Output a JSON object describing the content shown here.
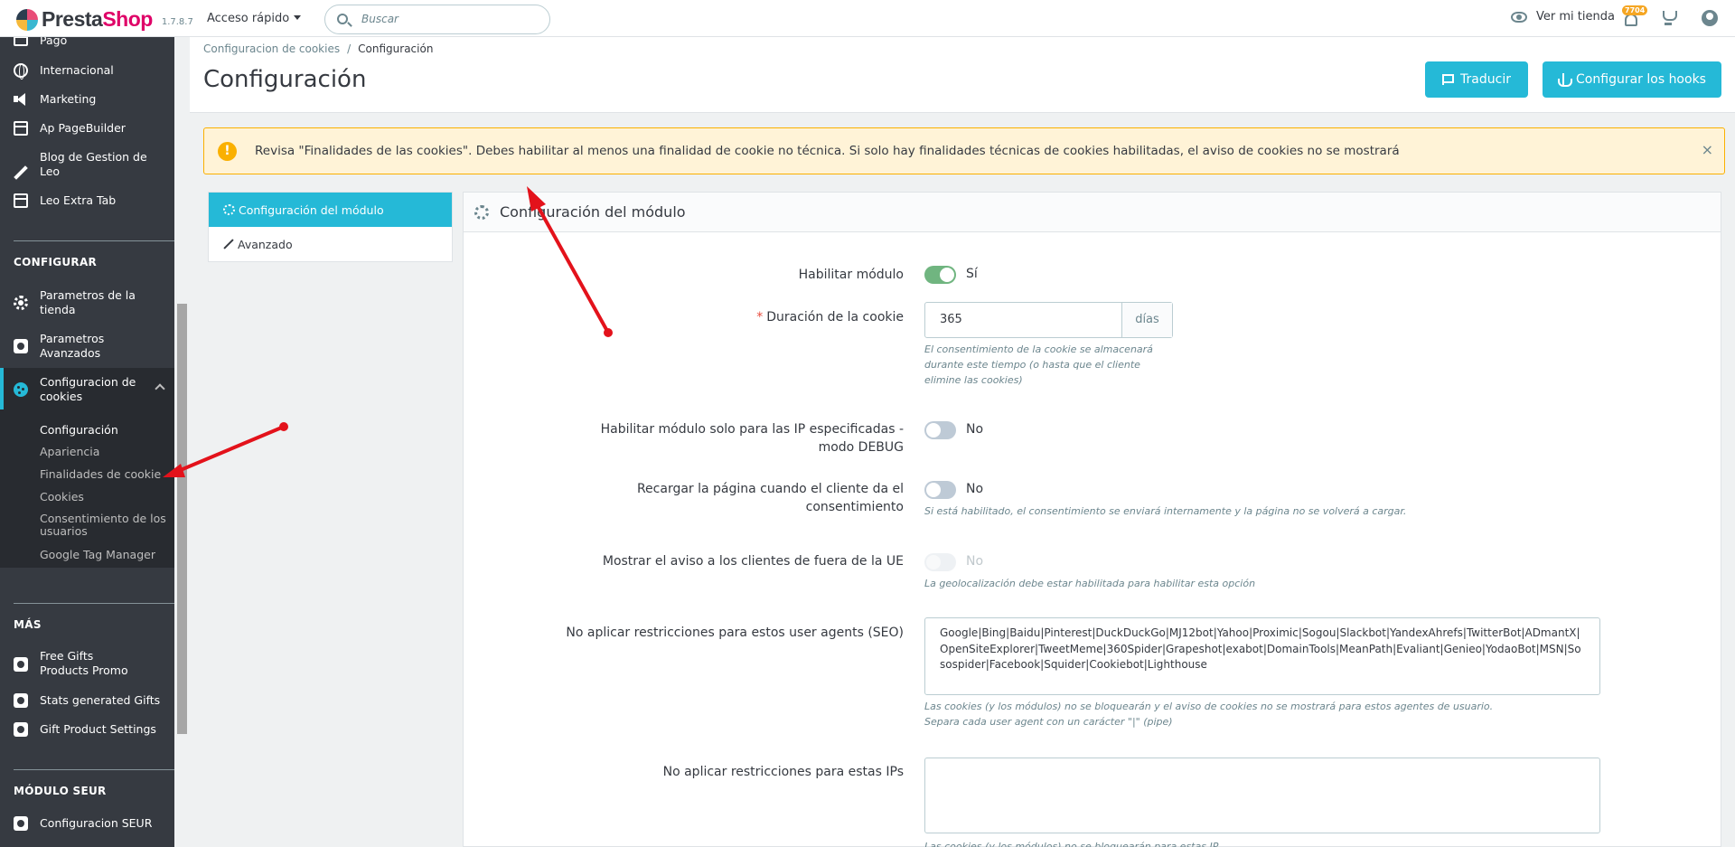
{
  "header": {
    "logo_text_1": "Presta",
    "logo_text_2": "Shop",
    "version": "1.7.8.7",
    "quick_access": "Acceso rápido",
    "search_placeholder": "Buscar",
    "view_store": "Ver mi tienda",
    "notifications_count": "7704"
  },
  "sidebar": {
    "items_top": [
      {
        "label": "Pago",
        "icon": "credit-card-icon"
      },
      {
        "label": "Internacional",
        "icon": "globe-icon"
      },
      {
        "label": "Marketing",
        "icon": "megaphone-icon"
      },
      {
        "label": "Ap PageBuilder",
        "icon": "window-icon"
      },
      {
        "label": "Blog de Gestion de Leo",
        "icon": "pencil-icon"
      },
      {
        "label": "Leo Extra Tab",
        "icon": "window-icon"
      }
    ],
    "section_configurar": "CONFIGURAR",
    "configurar_items": [
      {
        "label": "Parametros de la tienda",
        "icon": "gear-icon"
      },
      {
        "label": "Parametros Avanzados",
        "icon": "puzzle-icon"
      },
      {
        "label": "Configuracion de cookies",
        "icon": "cookie-icon"
      }
    ],
    "cookie_sub_items": [
      "Configuración",
      "Apariencia",
      "Finalidades de cookie",
      "Cookies",
      "Consentimiento de los usuarios",
      "Google Tag Manager"
    ],
    "section_mas": "MÁS",
    "mas_items": [
      {
        "label": "Free Gifts Products Promo",
        "icon": "puzzle-icon"
      },
      {
        "label": "Stats generated Gifts",
        "icon": "puzzle-icon"
      },
      {
        "label": "Gift Product Settings",
        "icon": "puzzle-icon"
      }
    ],
    "section_seur": "MÓDULO SEUR",
    "seur_items": [
      {
        "label": "Configuracion SEUR",
        "icon": "puzzle-icon"
      }
    ]
  },
  "page": {
    "breadcrumb_parent": "Configuracion de cookies",
    "breadcrumb_sep": "/",
    "breadcrumb_current": "Configuración",
    "title": "Configuración",
    "btn_translate": "Traducir",
    "btn_hooks": "Configurar los hooks"
  },
  "alert": {
    "icon": "!",
    "text": "Revisa \"Finalidades de las cookies\". Debes habilitar al menos una finalidad de cookie no técnica. Si solo hay finalidades técnicas de cookies habilitadas, el aviso de cookies no se mostrará",
    "close": "×"
  },
  "tabs": [
    {
      "label": "Configuración del módulo"
    },
    {
      "label": "Avanzado"
    }
  ],
  "panel": {
    "title": "Configuración del módulo",
    "fields": {
      "enable_module": {
        "label": "Habilitar módulo",
        "value": "Sí",
        "on": true
      },
      "cookie_duration": {
        "required_mark": "*",
        "label": "Duración de la cookie",
        "value": "365",
        "addon": "días",
        "help": "El consentimiento de la cookie se almacenará durante este tiempo (o hasta que el cliente elimine las cookies)"
      },
      "debug_ips": {
        "label": "Habilitar módulo solo para las IP especificadas - modo DEBUG",
        "value": "No",
        "on": false
      },
      "reload_page": {
        "label": "Recargar la página cuando el cliente da el consentimiento",
        "value": "No",
        "on": false,
        "help": "Si está habilitado, el consentimiento se enviará internamente y la página no se volverá a cargar."
      },
      "non_eu": {
        "label": "Mostrar el aviso a los clientes de fuera de la UE",
        "value": "No",
        "on": false,
        "help": "La geolocalización debe estar habilitada para habilitar esta opción"
      },
      "seo_agents": {
        "label": "No aplicar restricciones para estos user agents (SEO)",
        "value": "Google|Bing|Baidu|Pinterest|DuckDuckGo|MJ12bot|Yahoo|Proximic|Sogou|Slackbot|YandexAhrefs|TwitterBot|ADmantX|OpenSiteExplorer|TweetMeme|360Spider|Grapeshot|exabot|DomainTools|MeanPath|Evaliant|Genieo|YodaoBot|MSN|Sosospider|Facebook|Squider|Cookiebot|Lighthouse",
        "help_1": "Las cookies (y los módulos) no se bloquearán y el aviso de cookies no se mostrará para estos agentes de usuario.",
        "help_2": "Separa cada user agent con un carácter \"|\" (pipe)"
      },
      "no_restrict_ips": {
        "label": "No aplicar restricciones para estas IPs",
        "value": "",
        "help": "Las cookies (y los módulos) no se bloquearán para estas IP"
      }
    }
  },
  "colors": {
    "accent": "#25b9d7",
    "sidebar_bg": "#363a41",
    "alert_bg": "#fff3d7",
    "switch_on": "#70b580",
    "annotation_arrow": "#e3121b"
  }
}
